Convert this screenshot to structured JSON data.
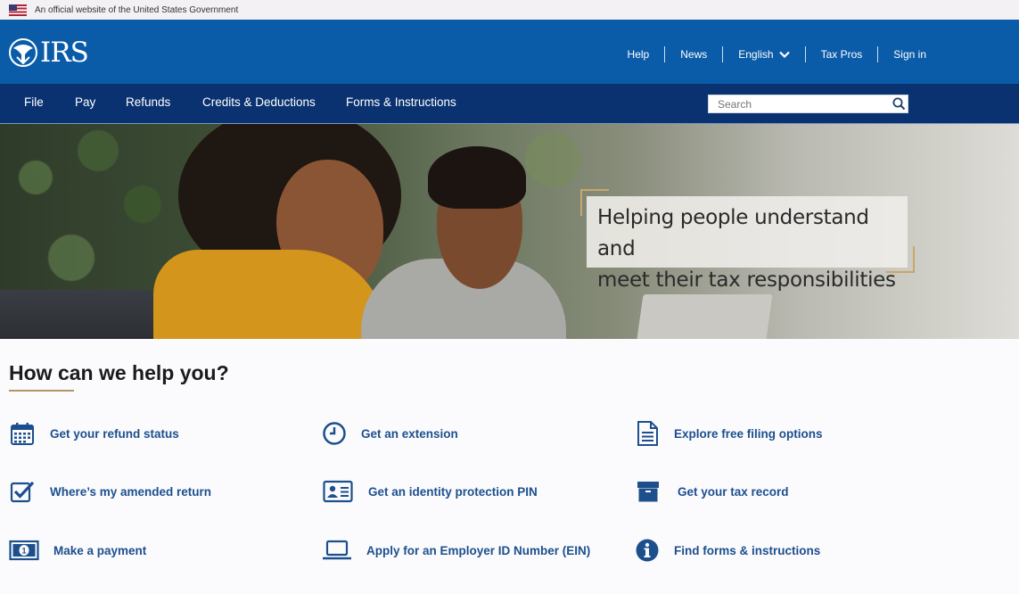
{
  "gov_banner": {
    "text": "An official website of the United States Government"
  },
  "header": {
    "logo_text": "IRS",
    "utility": [
      "Help",
      "News",
      "English",
      "Tax Pros",
      "Sign in"
    ]
  },
  "nav": {
    "items": [
      "File",
      "Pay",
      "Refunds",
      "Credits & Deductions",
      "Forms & Instructions"
    ],
    "search_placeholder": "Search"
  },
  "hero": {
    "caption_line1": "Helping people understand and",
    "caption_line2": "meet their tax responsibilities"
  },
  "help": {
    "title": "How can we help you?",
    "links": [
      {
        "label": "Get your refund status",
        "icon": "calendar-icon"
      },
      {
        "label": "Get an extension",
        "icon": "clock-icon"
      },
      {
        "label": "Explore free filing options",
        "icon": "document-icon"
      },
      {
        "label": "Where’s my amended return",
        "icon": "checkbox-icon"
      },
      {
        "label": "Get an identity protection PIN",
        "icon": "id-card-icon"
      },
      {
        "label": "Get your tax record",
        "icon": "archive-box-icon"
      },
      {
        "label": "Make a payment",
        "icon": "money-icon"
      },
      {
        "label": "Apply for an Employer ID Number (EIN)",
        "icon": "laptop-icon"
      },
      {
        "label": "Find forms & instructions",
        "icon": "info-icon"
      }
    ]
  },
  "colors": {
    "header_blue": "#0b5ca8",
    "nav_navy": "#0a3270",
    "link_blue": "#1c4f8c",
    "accent_gold": "#b59563"
  }
}
